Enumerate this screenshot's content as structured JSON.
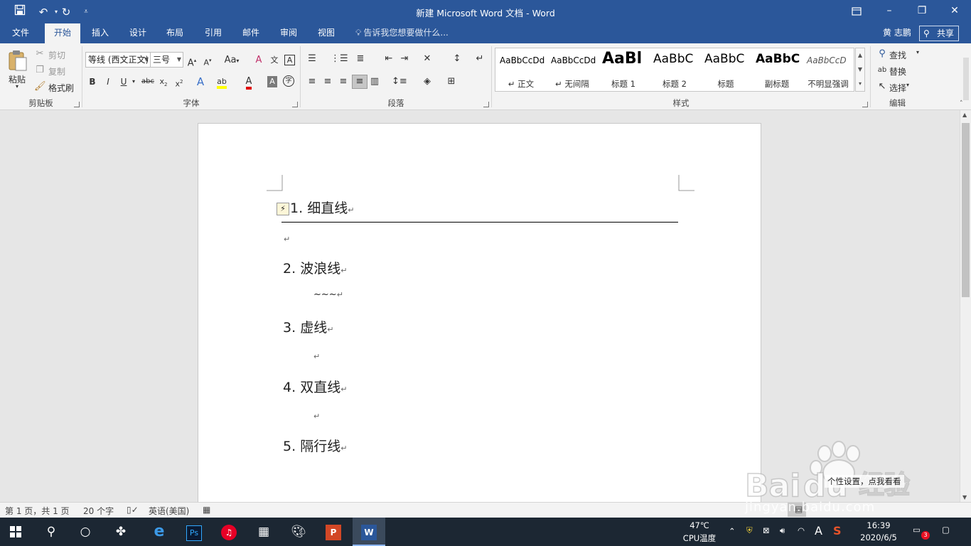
{
  "titlebar": {
    "title": "新建 Microsoft Word 文档 - Word"
  },
  "tabs": [
    {
      "label": "文件"
    },
    {
      "label": "开始"
    },
    {
      "label": "插入"
    },
    {
      "label": "设计"
    },
    {
      "label": "布局"
    },
    {
      "label": "引用"
    },
    {
      "label": "邮件"
    },
    {
      "label": "审阅"
    },
    {
      "label": "视图"
    }
  ],
  "tellme": "告诉我您想要做什么...",
  "user": {
    "name": "黄 志鹏",
    "share": "共享"
  },
  "clipboard": {
    "paste": "粘贴",
    "cut": "剪切",
    "copy": "复制",
    "format_painter": "格式刷",
    "label": "剪贴板"
  },
  "font": {
    "name": "等线 (西文正文)",
    "size": "三号",
    "label": "字体"
  },
  "paragraph": {
    "label": "段落"
  },
  "styles": {
    "label": "样式",
    "items": [
      {
        "sample": "AaBbCcDd",
        "name": "↵ 正文"
      },
      {
        "sample": "AaBbCcDd",
        "name": "↵ 无间隔"
      },
      {
        "sample": "AaBl",
        "name": "标题 1"
      },
      {
        "sample": "AaBbC",
        "name": "标题 2"
      },
      {
        "sample": "AaBbC",
        "name": "标题"
      },
      {
        "sample": "AaBbC",
        "name": "副标题"
      },
      {
        "sample": "AaBbCcD",
        "name": "不明显强调"
      }
    ]
  },
  "editing": {
    "find": "查找",
    "replace": "替换",
    "select": "选择",
    "label": "编辑"
  },
  "document": {
    "items": [
      {
        "num": "1.",
        "text": "细直线"
      },
      {
        "num": "2.",
        "text": "波浪线"
      },
      {
        "num": "3.",
        "text": "虚线"
      },
      {
        "num": "4.",
        "text": "双直线"
      },
      {
        "num": "5.",
        "text": "隔行线"
      }
    ],
    "wave": "~~~",
    "para_mark": "↵"
  },
  "statusbar": {
    "page": "第 1 页，共 1 页",
    "words": "20 个字",
    "language": "英语(美国)"
  },
  "taskbar": {
    "temp": "47℃",
    "temp_label": "CPU温度",
    "time": "16:39",
    "date": "2020/6/5",
    "notif_count": "3",
    "ime": "A"
  },
  "watermark": {
    "text": "jingyan.baidu.com",
    "tip": "个性设置，点我看看"
  }
}
